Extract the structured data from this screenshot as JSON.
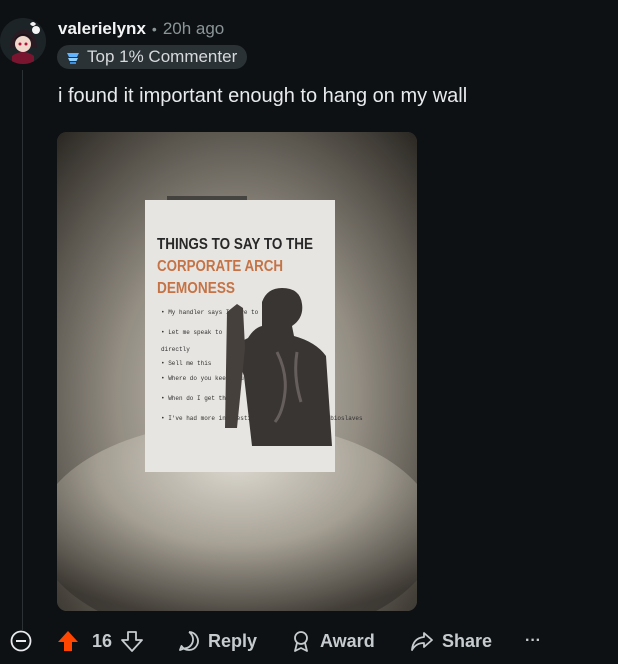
{
  "comment": {
    "username": "valerielynx",
    "separator": "•",
    "time": "20h ago",
    "flair": "Top 1% Commenter",
    "text": "i found it important enough to hang on my wall"
  },
  "poster": {
    "title_line1": "THINGS TO SAY TO THE",
    "title_line2": "CORPORATE ARCH",
    "title_line3": "DEMONESS",
    "items": [
      "• My handler says I have to kill you",
      "• Let me speak to",
      "directly",
      "• Sell me this",
      "• Where do you keep your Chunkpops?",
      "• When do I get the",
      "• I've had more interesting conversations with bioslaves"
    ]
  },
  "actions": {
    "score": "16",
    "reply_label": "Reply",
    "award_label": "Award",
    "share_label": "Share",
    "more_label": "···"
  },
  "colors": {
    "background": "#0e1113",
    "upvote_active": "#ff4500",
    "flair_bg": "#2a3236"
  }
}
